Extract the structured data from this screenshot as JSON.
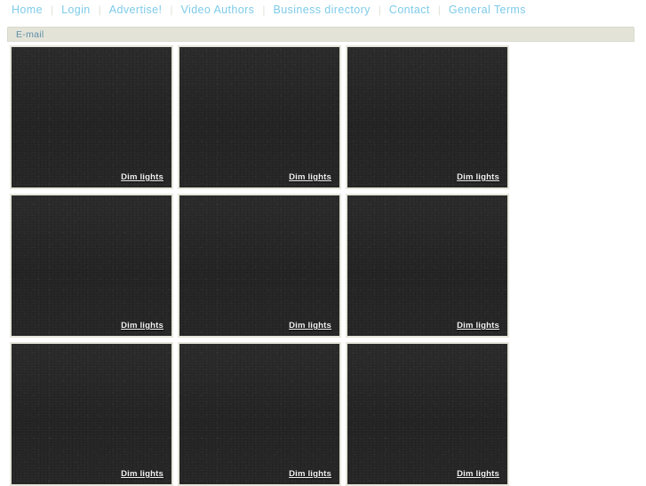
{
  "topnav": {
    "separator": "|",
    "items": [
      {
        "label": "Home",
        "name": "nav-link-home"
      },
      {
        "label": "Login",
        "name": "nav-link-login"
      },
      {
        "label": "Advertise!",
        "name": "nav-link-advertise"
      },
      {
        "label": "Video Authors",
        "name": "nav-link-video-authors"
      },
      {
        "label": "Business directory",
        "name": "nav-link-business-directory"
      },
      {
        "label": "Contact",
        "name": "nav-link-contact"
      },
      {
        "label": "General Terms",
        "name": "nav-link-general-terms"
      }
    ]
  },
  "email_bar": {
    "label": "E-mail"
  },
  "grid": {
    "dim_lights_label": "Dim lights",
    "rows": [
      {
        "cells": [
          {
            "dim_lights": "Dim lights"
          },
          {
            "dim_lights": "Dim lights"
          },
          {
            "dim_lights": "Dim lights"
          }
        ]
      },
      {
        "cells": [
          {
            "dim_lights": "Dim lights"
          },
          {
            "dim_lights": "Dim lights"
          },
          {
            "dim_lights": "Dim lights"
          }
        ]
      },
      {
        "cells": [
          {
            "dim_lights": "Dim lights"
          },
          {
            "dim_lights": "Dim lights"
          },
          {
            "dim_lights": "Dim lights"
          }
        ]
      }
    ]
  },
  "colors": {
    "nav_link": "#7ecbe8",
    "nav_separator": "#dfe4d8",
    "email_bar_bg": "#e3e3d8",
    "email_label": "#5f8fa6",
    "cell_bg": "#272727",
    "cell_border": "#e6e6dc",
    "page_bg": "#ffffff",
    "dim_lights_text": "#f2f2f2"
  }
}
